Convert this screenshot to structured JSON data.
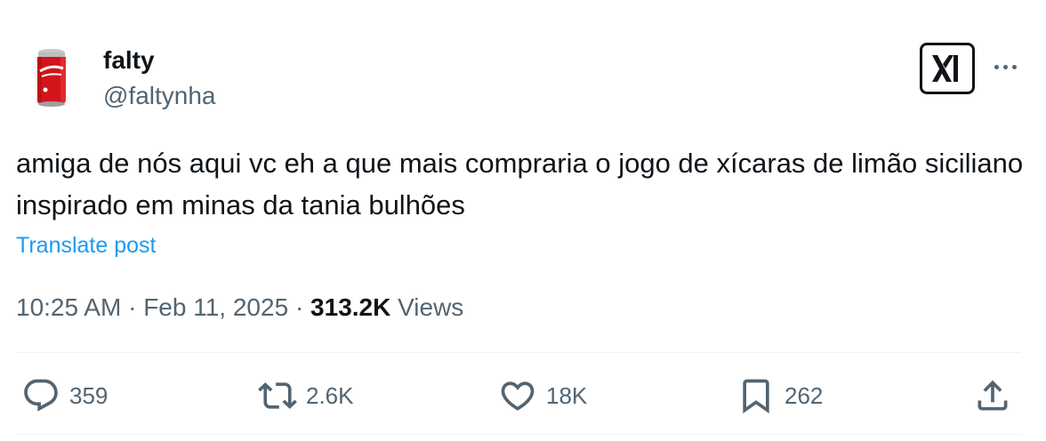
{
  "author": {
    "display_name": "falty",
    "handle": "@faltynha",
    "avatar_icon": "soda-can-icon"
  },
  "header_icons": {
    "badge": "xai-logo-icon",
    "more": "more-options-icon"
  },
  "post": {
    "text": "amiga de nós aqui vc eh a que mais compraria o jogo de xícaras de limão siciliano inspirado em minas da tania bulhões",
    "translate_label": "Translate post"
  },
  "meta": {
    "time": "10:25 AM",
    "separator": "·",
    "date": "Feb 11, 2025",
    "views_count": "313.2K",
    "views_label": "Views"
  },
  "actions": {
    "replies": "359",
    "reposts": "2.6K",
    "likes": "18K",
    "bookmarks": "262"
  },
  "colors": {
    "text_primary": "#0f1419",
    "text_secondary": "#536471",
    "link": "#1d9bf0",
    "divider": "#eff3f4",
    "can_red": "#d3141b"
  }
}
